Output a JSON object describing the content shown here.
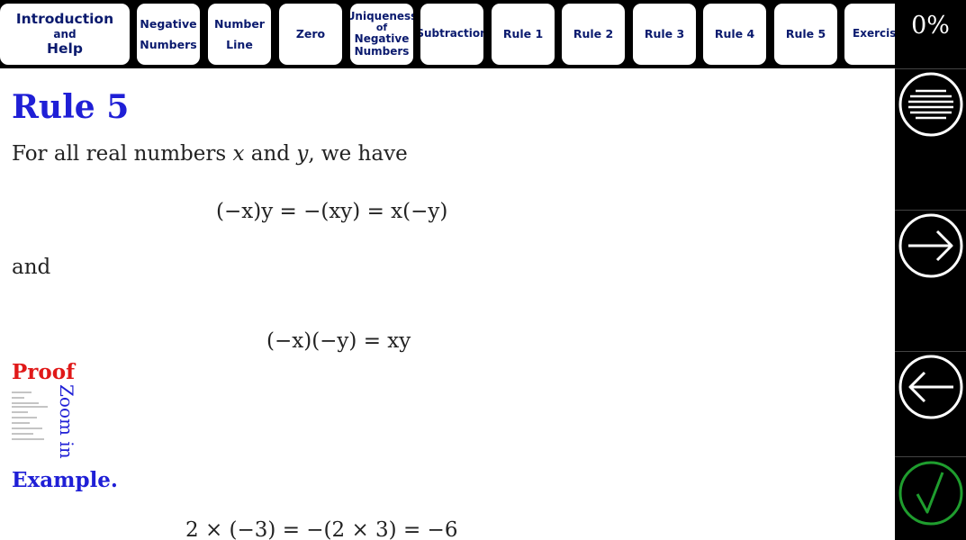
{
  "nav": {
    "intro": {
      "line1": "Introduction",
      "line2": "and",
      "line3": "Help"
    },
    "negative_numbers": {
      "line1": "Negative",
      "line2": "Numbers"
    },
    "number_line": {
      "line1": "Number",
      "line2": "Line"
    },
    "zero": "Zero",
    "uniqueness": {
      "line1": "Uniqueness",
      "line2": "of",
      "line3": "Negative",
      "line4": "Numbers"
    },
    "subtraction": "Subtraction",
    "rule1": "Rule 1",
    "rule2": "Rule 2",
    "rule3": "Rule 3",
    "rule4": "Rule 4",
    "rule5": "Rule 5",
    "exercise": "Exercise"
  },
  "sidebar": {
    "progress": "0%",
    "icons": [
      "menu-icon",
      "arrow-right-icon",
      "arrow-left-icon",
      "checkmark-icon"
    ],
    "colors": {
      "check": "#1f9d2e",
      "circle": "#ffffff"
    }
  },
  "content": {
    "title": "Rule 5",
    "statement": {
      "pre": "For all real numbers ",
      "x": "x",
      "mid": " and ",
      "y": "y",
      "post": ", we have"
    },
    "equation1": "(−x)y  =  −(xy)  =  x(−y)",
    "and": "and",
    "equation2": "(−x)(−y)  =  xy",
    "proof_label": "Proof",
    "zoom_label": "Zoom in",
    "example_label": "Example.",
    "example_equation": "2 × (−3)  =  −(2 × 3)  =  −6"
  },
  "colors": {
    "title": "#1f1fd6",
    "proof": "#e01818",
    "nav_text": "#0a1a6e"
  }
}
